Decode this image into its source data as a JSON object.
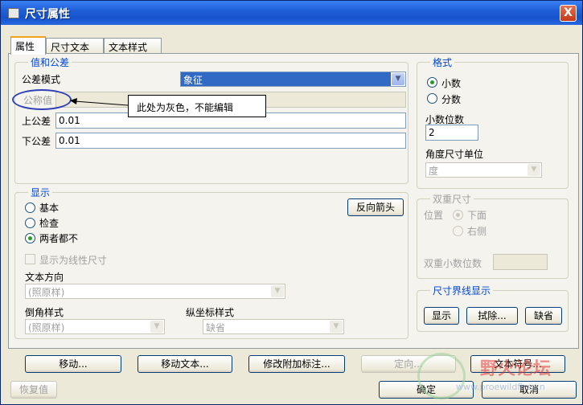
{
  "window": {
    "title": "尺寸属性",
    "close_glyph": "X"
  },
  "tabs": [
    {
      "label": "属性",
      "active": true
    },
    {
      "label": "尺寸文本",
      "active": false
    },
    {
      "label": "文本样式",
      "active": false
    }
  ],
  "value_tolerance": {
    "legend": "值和公差",
    "tolerance_mode_label": "公差模式",
    "tolerance_mode_value": "象征",
    "nominal_label": "公称值",
    "upper_label": "上公差",
    "upper_value": "0.01",
    "lower_label": "下公差",
    "lower_value": "0.01"
  },
  "annotation": {
    "callout_text": "此处为灰色，不能编辑"
  },
  "format": {
    "legend": "格式",
    "decimal_label": "小数",
    "fraction_label": "分数",
    "selected": "decimal",
    "decimal_places_label": "小数位数",
    "decimal_places_value": "2",
    "angle_unit_label": "角度尺寸单位",
    "angle_unit_value": "度"
  },
  "display": {
    "legend": "显示",
    "basic_label": "基本",
    "inspect_label": "检查",
    "neither_label": "两者都不",
    "selected": "neither",
    "flip_arrows_label": "反向箭头",
    "show_linear_label": "显示为线性尺寸",
    "text_direction_label": "文本方向",
    "text_direction_value": "(照原样)",
    "chamfer_style_label": "倒角样式",
    "chamfer_style_value": "(照原样)",
    "ordinate_style_label": "纵坐标样式",
    "ordinate_style_value": "缺省"
  },
  "dual_dim": {
    "legend": "双重尺寸",
    "position_label": "位置",
    "below_label": "下面",
    "right_label": "右侧",
    "dual_decimals_label": "双重小数位数"
  },
  "witness": {
    "legend": "尺寸界线显示",
    "show_label": "显示",
    "erase_label": "拭除...",
    "default_label": "缺省"
  },
  "bottom_buttons": {
    "move": "移动...",
    "move_text": "移动文本...",
    "edit_attached": "修改附加标注...",
    "orient": "定向...",
    "text_symbol": "文本符号..."
  },
  "footer": {
    "restore": "恢复值",
    "ok": "确定",
    "cancel": "取消"
  },
  "watermark": {
    "text": "野火论坛",
    "url": "www.proewildfire.cn"
  }
}
